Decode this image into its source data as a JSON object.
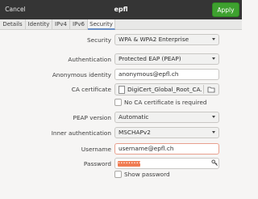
{
  "header": {
    "cancel_label": "Cancel",
    "title": "epfl",
    "apply_label": "Apply",
    "apply_color": "#3ea12f"
  },
  "tabs": [
    "Details",
    "Identity",
    "IPv4",
    "IPv6",
    "Security"
  ],
  "active_tab": "Security",
  "form": {
    "security": {
      "label": "Security",
      "value": "WPA & WPA2 Enterprise"
    },
    "authentication": {
      "label": "Authentication",
      "value": "Protected EAP (PEAP)"
    },
    "anonymous_identity": {
      "label": "Anonymous identity",
      "value": "anonymous@epfl.ch"
    },
    "ca_certificate": {
      "label": "CA certificate",
      "value": "DigiCert_Global_Root_CA...",
      "icon": "document-icon",
      "button_icon": "open-file-icon"
    },
    "no_ca_required": {
      "label": "No CA certificate is required",
      "checked": false
    },
    "peap_version": {
      "label": "PEAP version",
      "value": "Automatic"
    },
    "inner_authentication": {
      "label": "Inner authentication",
      "value": "MSCHAPv2"
    },
    "username": {
      "label": "Username",
      "value": "username@epfl.ch"
    },
    "password": {
      "label": "Password",
      "value": "•••••••••",
      "mask_color": "#f07c52",
      "icon": "key-icon"
    },
    "show_password": {
      "label": "Show password",
      "checked": false
    }
  }
}
